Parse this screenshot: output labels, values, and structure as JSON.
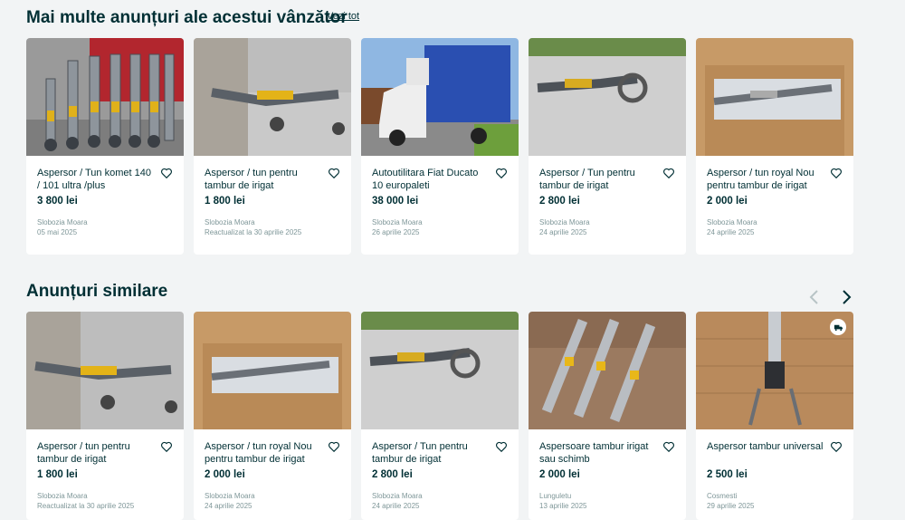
{
  "seller_section": {
    "title": "Mai multe anunțuri ale acestui vânzător",
    "see_all": "Vezi tot",
    "items": [
      {
        "title": "Aspersor / Tun komet 140 / 101 ultra /plus",
        "price": "3 800 lei",
        "location": "Slobozia Moara",
        "date": "05 mai 2025"
      },
      {
        "title": "Aspersor / tun pentru tambur de irigat",
        "price": "1 800 lei",
        "location": "Slobozia Moara",
        "date": "Reactualizat la 30 aprilie 2025"
      },
      {
        "title": "Autoutilitara Fiat Ducato 10 europaleti",
        "price": "38 000 lei",
        "location": "Slobozia Moara",
        "date": "26 aprilie 2025"
      },
      {
        "title": "Aspersor / Tun pentru tambur de irigat",
        "price": "2 800 lei",
        "location": "Slobozia Moara",
        "date": "24 aprilie 2025"
      },
      {
        "title": "Aspersor / tun royal Nou pentru tambur de irigat",
        "price": "2 000 lei",
        "location": "Slobozia Moara",
        "date": "24 aprilie 2025"
      }
    ]
  },
  "similar_section": {
    "title": "Anunțuri similare",
    "items": [
      {
        "title": "Aspersor / tun pentru tambur de irigat",
        "price": "1 800 lei",
        "location": "Slobozia Moara",
        "date": "Reactualizat la 30 aprilie 2025"
      },
      {
        "title": "Aspersor / tun royal Nou pentru tambur de irigat",
        "price": "2 000 lei",
        "location": "Slobozia Moara",
        "date": "24 aprilie 2025"
      },
      {
        "title": "Aspersor / Tun pentru tambur de irigat",
        "price": "2 800 lei",
        "location": "Slobozia Moara",
        "date": "24 aprilie 2025"
      },
      {
        "title": "Aspersoare tambur irigat sau schimb",
        "price": "2 000 lei",
        "location": "Lunguletu",
        "date": "13 aprilie 2025"
      },
      {
        "title": "Aspersor tambur universal",
        "price": "2 500 lei",
        "location": "Cosmesti",
        "date": "29 aprilie 2025"
      }
    ]
  },
  "icons": {
    "heart": "heart-icon",
    "prev": "chevron-left-icon",
    "next": "chevron-right-icon",
    "delivery": "delivery-truck-icon"
  },
  "colors": {
    "text": "#002f34",
    "muted": "#7f9799",
    "background": "#f2f4f5",
    "card": "#ffffff"
  }
}
